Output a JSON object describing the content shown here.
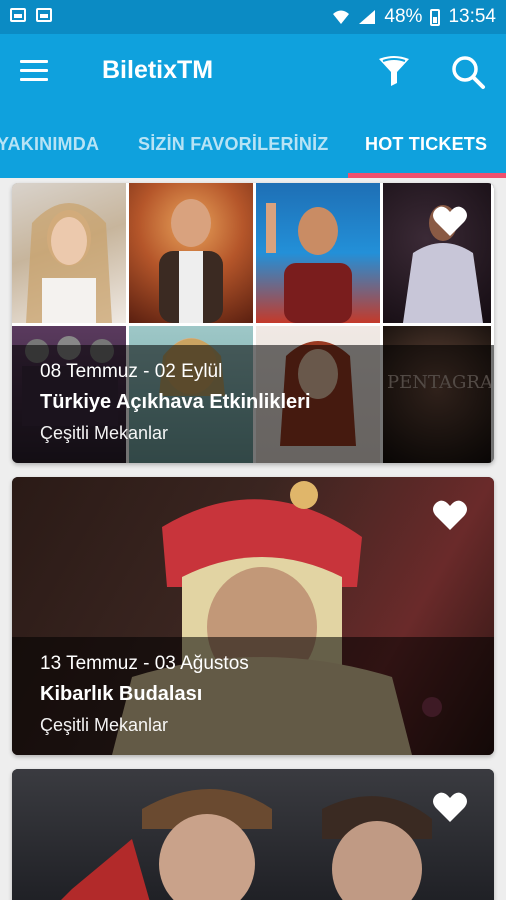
{
  "status_bar": {
    "battery": "48%",
    "time": "13:54",
    "icons": [
      "image-icon",
      "gallery-icon",
      "wifi-icon",
      "signal-icon",
      "battery-icon"
    ]
  },
  "app_bar": {
    "title": "BiletixTM",
    "icons": [
      "menu-icon",
      "filter-icon",
      "search-icon"
    ],
    "color": "#0fa1dd"
  },
  "tabs": [
    {
      "label": "YAKINIMDA"
    },
    {
      "label": "SİZİN FAVORİLERİNİZ"
    },
    {
      "label": "HOT TICKETS",
      "active": true
    }
  ],
  "accent_color": "#f0506e",
  "cards": [
    {
      "date": "08 Temmuz - 02 Eylül",
      "title": "Türkiye Açıkhava Etkinlikleri",
      "venue": "Çeşitli Mekanlar",
      "favorite_icon": "heart-icon"
    },
    {
      "date": "13 Temmuz - 03 Ağustos",
      "title": "Kibarlık Budalası",
      "venue": "Çeşitli Mekanlar",
      "favorite_icon": "heart-icon"
    },
    {
      "favorite_icon": "heart-icon"
    }
  ]
}
